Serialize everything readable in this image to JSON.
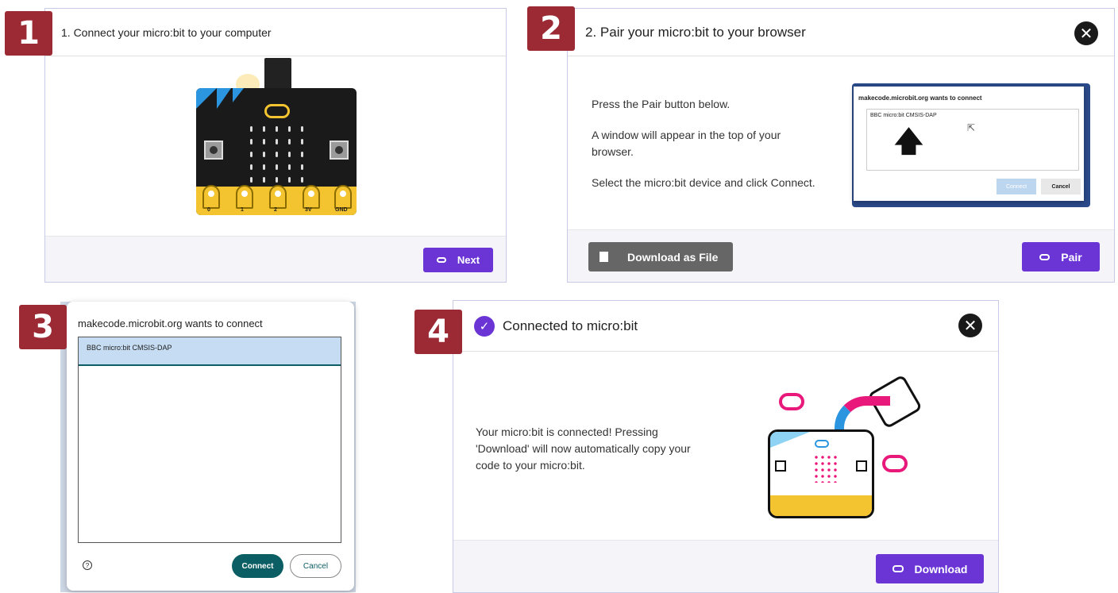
{
  "step1": {
    "badge": "1",
    "title": "1. Connect your micro:bit to your computer",
    "next_label": "Next",
    "pins": [
      "0",
      "1",
      "2",
      "3V",
      "GND"
    ]
  },
  "step2": {
    "badge": "2",
    "title": "2. Pair your micro:bit to your browser",
    "instr1": "Press the Pair button below.",
    "instr2": "A window will appear in the top of your browser.",
    "instr3": "Select the micro:bit device and click Connect.",
    "download_label": "Download as File",
    "pair_label": "Pair",
    "mini_title": "makecode.microbit.org wants to connect",
    "mini_device": "BBC micro:bit CMSIS-DAP",
    "mini_connect": "Connect",
    "mini_cancel": "Cancel"
  },
  "step3": {
    "badge": "3",
    "title": "makecode.microbit.org wants to connect",
    "device": "BBC micro:bit CMSIS-DAP",
    "connect_label": "Connect",
    "cancel_label": "Cancel",
    "help_icon": "?"
  },
  "step4": {
    "badge": "4",
    "title": "Connected to micro:bit",
    "message": "Your micro:bit is connected! Pressing 'Download' will now automatically copy your code to your micro:bit.",
    "download_label": "Download"
  },
  "colors": {
    "badge": "#9b2a35",
    "accent": "#6b35d6",
    "teal": "#0b5e63"
  }
}
